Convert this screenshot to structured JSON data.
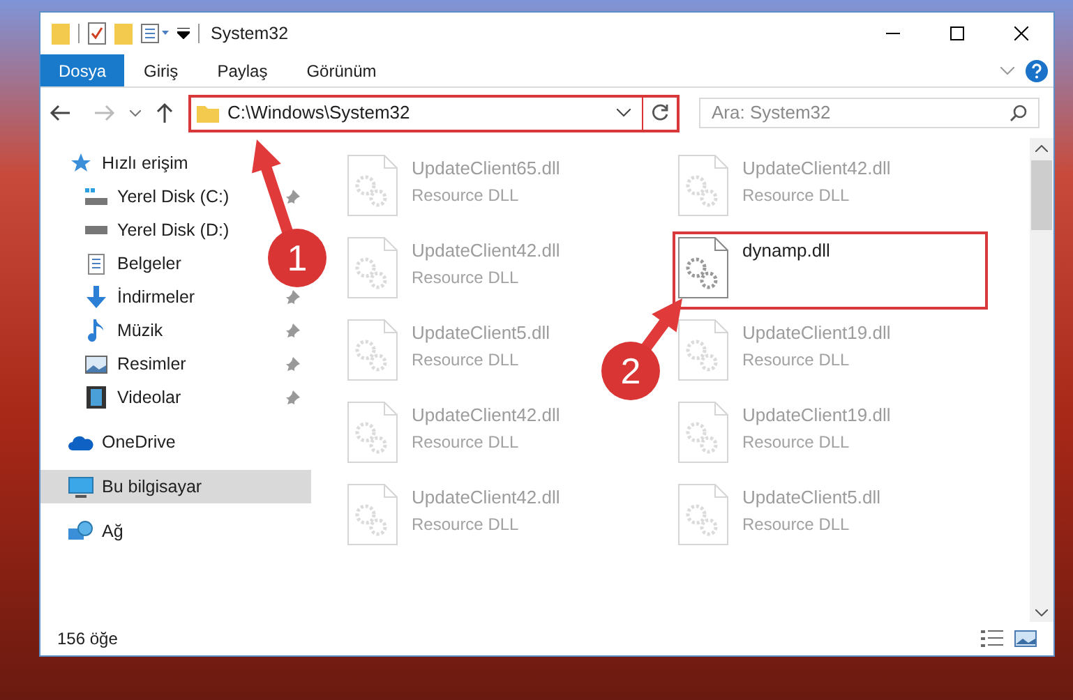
{
  "window": {
    "title": "System32"
  },
  "ribbon": {
    "tabs": [
      {
        "label": "Dosya",
        "kind": "file"
      },
      {
        "label": "Giriş",
        "kind": "tab"
      },
      {
        "label": "Paylaş",
        "kind": "tab"
      },
      {
        "label": "Görünüm",
        "kind": "tab"
      }
    ]
  },
  "address_bar": {
    "path": "C:\\Windows\\System32",
    "highlighted": true
  },
  "search": {
    "placeholder": "Ara: System32"
  },
  "navigation": [
    {
      "label": "Hızlı erişim",
      "kind": "star",
      "selected": false,
      "children": [
        {
          "label": "Yerel Disk (C:)",
          "kind": "drive-c",
          "pinned": true,
          "selected": false
        },
        {
          "label": "Yerel Disk (D:)",
          "kind": "drive",
          "pinned": false,
          "selected": false
        },
        {
          "label": "Belgeler",
          "kind": "docs",
          "pinned": false,
          "selected": false
        },
        {
          "label": "İndirmeler",
          "kind": "download",
          "pinned": true,
          "selected": false
        },
        {
          "label": "Müzik",
          "kind": "music",
          "pinned": true,
          "selected": false
        },
        {
          "label": "Resimler",
          "kind": "pictures",
          "pinned": true,
          "selected": false
        },
        {
          "label": "Videolar",
          "kind": "videos",
          "pinned": true,
          "selected": false
        }
      ]
    },
    {
      "label": "OneDrive",
      "kind": "cloud",
      "selected": false
    },
    {
      "label": "Bu bilgisayar",
      "kind": "pc",
      "selected": true
    },
    {
      "label": "Ağ",
      "kind": "network",
      "selected": false
    }
  ],
  "files": [
    {
      "name": "UpdateClient65.dll",
      "type": "Resource DLL",
      "blurred": true,
      "highlighted": false
    },
    {
      "name": "UpdateClient42.dll",
      "type": "Resource DLL",
      "blurred": true,
      "highlighted": false
    },
    {
      "name": "UpdateClient42.dll",
      "type": "Resource DLL",
      "blurred": true,
      "highlighted": false
    },
    {
      "name": "dynamp.dll",
      "blurred": false,
      "highlighted": true
    },
    {
      "name": "UpdateClient5.dll",
      "type": "Resource DLL",
      "blurred": true,
      "highlighted": false
    },
    {
      "name": "UpdateClient19.dll",
      "type": "Resource DLL",
      "blurred": true,
      "highlighted": false
    },
    {
      "name": "UpdateClient42.dll",
      "type": "Resource DLL",
      "blurred": true,
      "highlighted": false
    },
    {
      "name": "UpdateClient19.dll",
      "type": "Resource DLL",
      "blurred": true,
      "highlighted": false
    },
    {
      "name": "UpdateClient42.dll",
      "type": "Resource DLL",
      "blurred": true,
      "highlighted": false
    },
    {
      "name": "UpdateClient5.dll",
      "type": "Resource DLL",
      "blurred": true,
      "highlighted": false
    }
  ],
  "annotations": [
    {
      "label": "1"
    },
    {
      "label": "2"
    }
  ],
  "status_bar": {
    "count": "156 öğe"
  }
}
